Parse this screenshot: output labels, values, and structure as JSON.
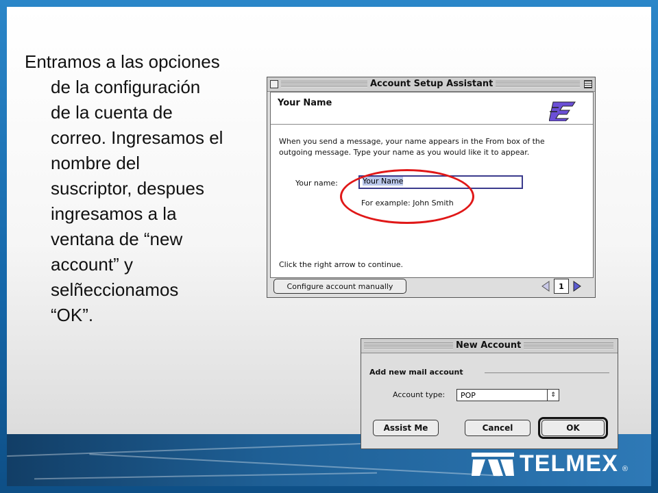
{
  "slide": {
    "paragraph": "Entramos a las opciones de la configuración de la cuenta de correo. Ingresamos el nombre del suscriptor, despues ingresamos a la ventana de “new account” y selñeccionamos “OK”.",
    "lines": [
      "Entramos a las",
      "opciones de la",
      "configuración de",
      "la cuenta de",
      "correo.",
      "Ingresamos el",
      "nombre del",
      "suscriptor,",
      "despues",
      "ingresamos a la",
      "ventana de “new",
      "account” y",
      "selñeccionamos",
      "“OK”."
    ]
  },
  "account_setup": {
    "title": "Account Setup Assistant",
    "heading": "Your Name",
    "description_line1": "When you send a message, your name appears in the From box of the",
    "description_line2": "outgoing message. Type your name as you would like it to appear.",
    "name_label": "Your name:",
    "name_value": "Your Name",
    "example": "For example: John Smith",
    "hint": "Click the right arrow to continue.",
    "configure_button": "Configure account manually",
    "page_number": "1",
    "logo_icon": "outlook-express-logo-icon"
  },
  "new_account": {
    "title": "New Account",
    "section_label": "Add new mail account",
    "type_label": "Account type:",
    "type_value": "POP",
    "assist_button": "Assist Me",
    "cancel_button": "Cancel",
    "ok_button": "OK"
  },
  "branding": {
    "logo_text": "TELMEX",
    "registered": "®"
  },
  "colors": {
    "highlight_ellipse": "#e01818",
    "frame_blue": "#1b6fae"
  }
}
